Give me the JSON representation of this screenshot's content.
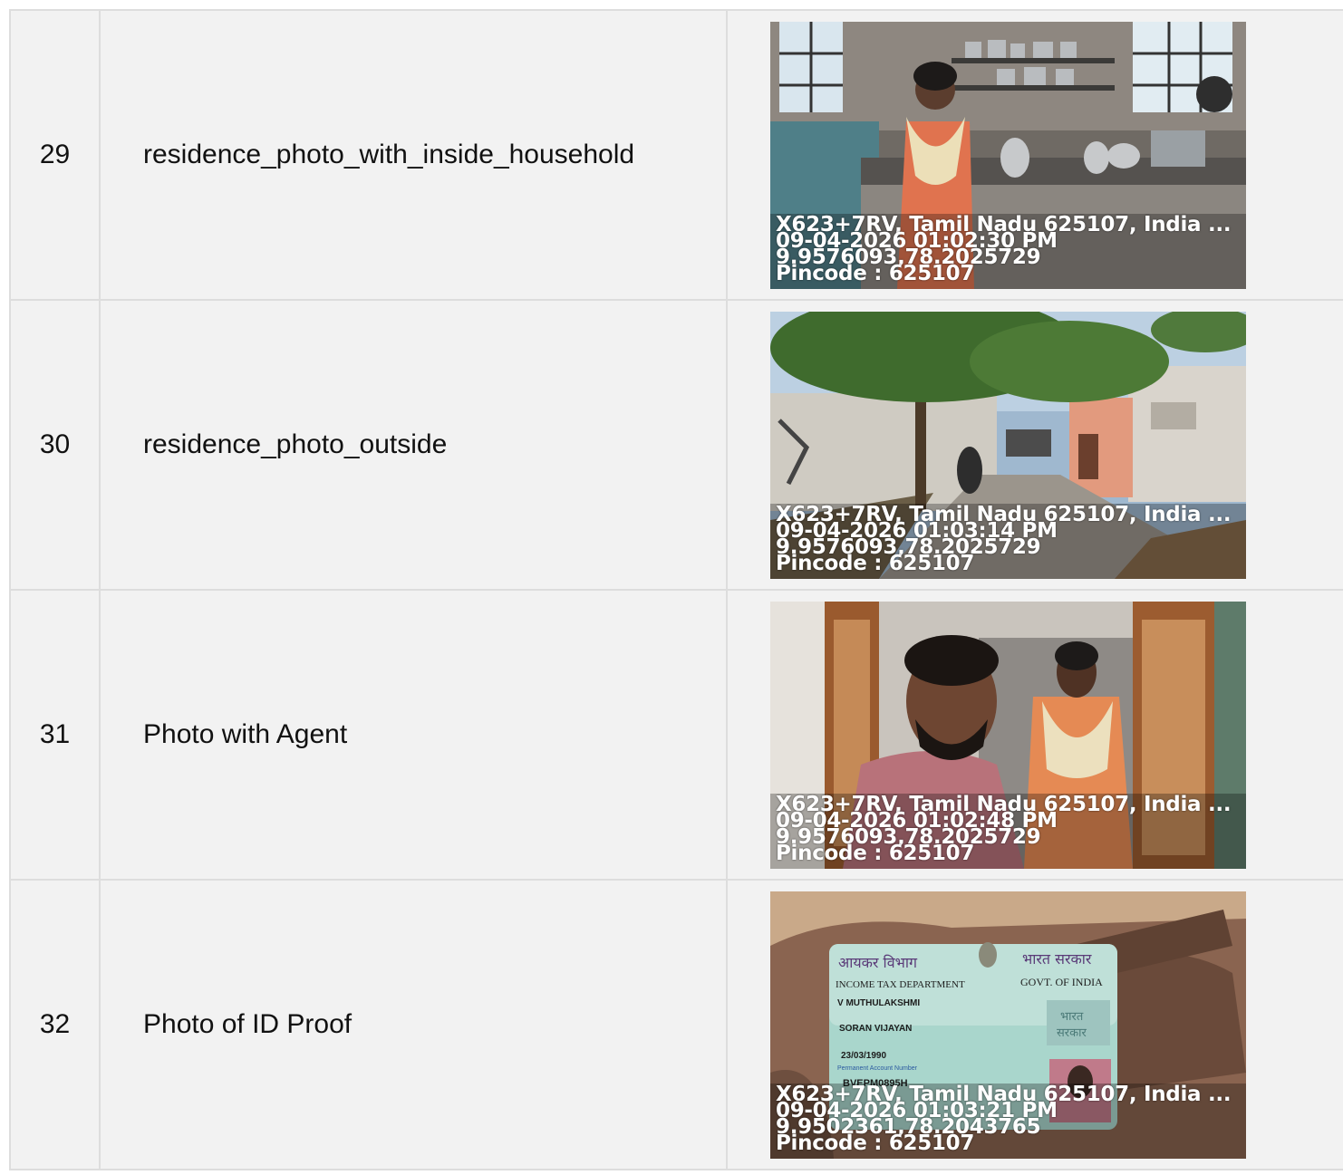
{
  "rows": [
    {
      "number": "29",
      "label": "residence_photo_with_inside_household",
      "photo": {
        "subject": "kitchen-scene",
        "stamp": {
          "address": "X623+7RV, Tamil Nadu 625107, India ...",
          "datetime": "09-04-2026 01:02:30 PM",
          "coords": "9.9576093,78.2025729",
          "pincode": "Pincode : 625107"
        }
      }
    },
    {
      "number": "30",
      "label": "residence_photo_outside",
      "photo": {
        "subject": "street-scene",
        "stamp": {
          "address": "X623+7RV, Tamil Nadu 625107, India ...",
          "datetime": "09-04-2026 01:03:14 PM",
          "coords": "9.9576093,78.2025729",
          "pincode": "Pincode : 625107"
        }
      }
    },
    {
      "number": "31",
      "label": "Photo with Agent",
      "photo": {
        "subject": "selfie-scene",
        "stamp": {
          "address": "X623+7RV, Tamil Nadu 625107, India ...",
          "datetime": "09-04-2026 01:02:48 PM",
          "coords": "9.9576093,78.2025729",
          "pincode": "Pincode : 625107"
        }
      }
    },
    {
      "number": "32",
      "label": "Photo of ID Proof",
      "photo": {
        "subject": "id-card-in-hand",
        "card": {
          "dept_hindi": "आयकर विभाग",
          "govt_hindi": "भारत सरकार",
          "dept_english": "INCOME TAX DEPARTMENT",
          "govt_english": "GOVT. OF INDIA",
          "name": "V MUTHULAKSHMI",
          "father_name": "SORAN VIJAYAN",
          "dob": "23/03/1990",
          "pan_label": "Permanent Account Number",
          "pan": "BVEPM0895H",
          "hologram_line1": "भारत",
          "hologram_line2": "सरकार"
        },
        "stamp": {
          "address": "X623+7RV, Tamil Nadu 625107, India ...",
          "datetime": "09-04-2026 01:03:21 PM",
          "coords": "9.9502361,78.2043765",
          "pincode": "Pincode : 625107"
        }
      }
    }
  ]
}
